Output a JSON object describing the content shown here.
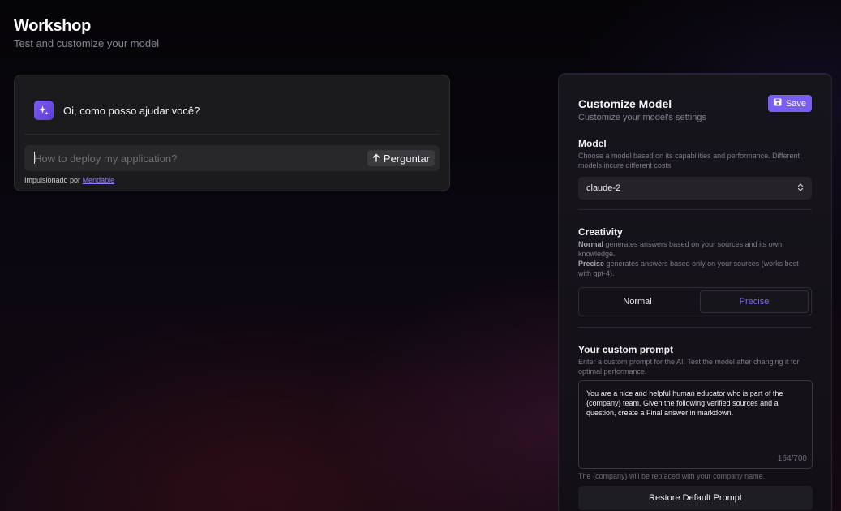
{
  "page": {
    "title": "Workshop",
    "subtitle": "Test and customize your model"
  },
  "chat": {
    "greeting": "Oi, como posso ajudar você?",
    "input_placeholder": "How to deploy my application?",
    "input_value": "",
    "ask_label": "Perguntar",
    "powered_prefix": "Impulsionado por",
    "powered_link": "Mendable"
  },
  "customize": {
    "title": "Customize Model",
    "subtitle": "Customize your model's settings",
    "save_label": "Save",
    "model": {
      "title": "Model",
      "description": "Choose a model based on its capabilities and performance. Different models incure different costs",
      "selected": "claude-2"
    },
    "creativity": {
      "title": "Creativity",
      "normal_term": "Normal",
      "normal_desc": " generates answers based on your sources and its own knowledge.",
      "precise_term": "Precise",
      "precise_desc": " generates answers based only on your sources (works best with gpt-4).",
      "options": [
        "Normal",
        "Precise"
      ],
      "selected": "Precise"
    },
    "prompt": {
      "title": "Your custom prompt",
      "description": "Enter a custom prompt for the AI. Test the model after changing it for optimal performance.",
      "value": "You are a nice and helpful human educator who is part of the {company} team. Given the following verified sources and a question, create a Final answer in markdown.",
      "count": "164/700",
      "note": "The {company} will be replaced with your company name.",
      "restore_label": "Restore Default Prompt"
    }
  },
  "colors": {
    "accent": "#7a5df2",
    "accent_text": "#7b66f0",
    "card_bg": "#1b1b1d"
  },
  "icons": {
    "bot": "sparkles-icon",
    "ask": "arrow-up-icon",
    "save": "floppy-disk-icon",
    "select": "chevron-up-down-icon"
  }
}
